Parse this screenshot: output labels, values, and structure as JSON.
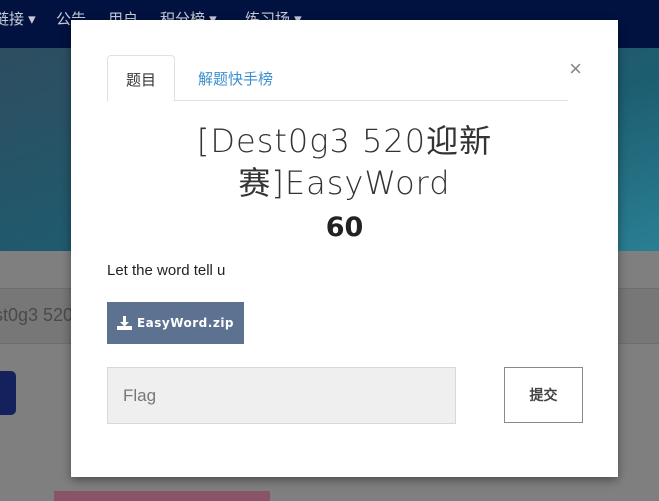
{
  "navbar": {
    "items": [
      "链接 ▾",
      "公告",
      "用户",
      "积分榜 ▾",
      "练习场 ▾"
    ]
  },
  "background": {
    "breadcrumb": "st0g3 520"
  },
  "modal": {
    "tabs": [
      {
        "label": "题目"
      },
      {
        "label": "解题快手榜"
      }
    ],
    "close_label": "×",
    "title": "[Dest0g3 520迎新赛]EasyWord",
    "value": "60",
    "description": "Let the word tell u",
    "download": {
      "label": "EasyWord.zip",
      "icon": "download-icon"
    },
    "flag_placeholder": "Flag",
    "submit_label": "提交"
  }
}
